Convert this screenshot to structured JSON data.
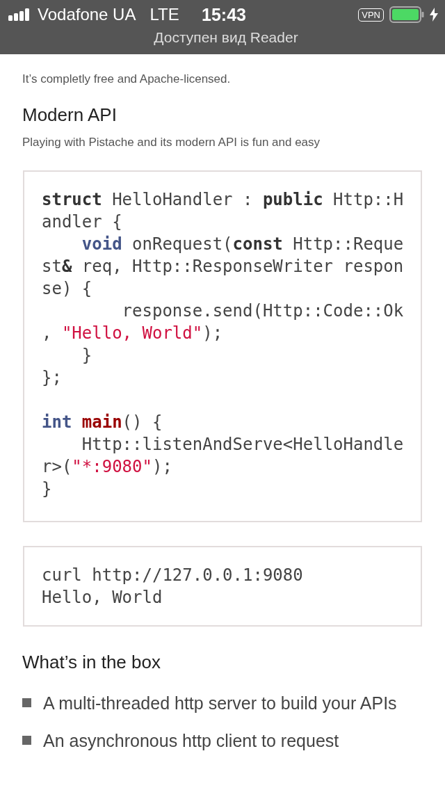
{
  "status_bar": {
    "carrier": "Vodafone UA",
    "network": "LTE",
    "time": "15:43",
    "vpn": "VPN",
    "reader_notice": "Доступен вид Reader"
  },
  "intro": "It’s completly free and Apache-licensed.",
  "modern_api": {
    "heading": "Modern API",
    "subtitle": "Playing with Pistache and its modern API is fun and easy"
  },
  "code_blocks": [
    {
      "lines": [
        {
          "kind": "code",
          "segments": [
            {
              "t": "struct",
              "kind": "keyword"
            },
            {
              "t": " HelloHandler : ",
              "kind": "plain"
            },
            {
              "t": "public",
              "kind": "keyword"
            },
            {
              "t": " Http::H",
              "kind": "plain"
            }
          ]
        },
        {
          "kind": "code",
          "segments": [
            {
              "t": "andler {",
              "kind": "plain"
            }
          ]
        },
        {
          "kind": "code",
          "segments": [
            {
              "t": "    void",
              "kind": "type"
            },
            {
              "t": " onRequest(",
              "kind": "plain"
            },
            {
              "t": "const",
              "kind": "keyword"
            },
            {
              "t": " Http::Reque",
              "kind": "plain"
            }
          ]
        },
        {
          "kind": "code",
          "segments": [
            {
              "t": "st",
              "kind": "plain"
            },
            {
              "t": "&",
              "kind": "keyword"
            },
            {
              "t": " req, Http::ResponseWriter respon",
              "kind": "plain"
            }
          ]
        },
        {
          "kind": "code",
          "segments": [
            {
              "t": "se) {",
              "kind": "plain"
            }
          ]
        },
        {
          "kind": "code",
          "segments": [
            {
              "t": "        response.send(Http::Code::Ok",
              "kind": "plain"
            }
          ]
        },
        {
          "kind": "code",
          "segments": [
            {
              "t": ", ",
              "kind": "plain"
            },
            {
              "t": "\"Hello, World\"",
              "kind": "string"
            },
            {
              "t": ");",
              "kind": "plain"
            }
          ]
        },
        {
          "kind": "code",
          "segments": [
            {
              "t": "    }",
              "kind": "plain"
            }
          ]
        },
        {
          "kind": "code",
          "segments": [
            {
              "t": "};",
              "kind": "plain"
            }
          ]
        },
        {
          "kind": "blank"
        },
        {
          "kind": "code",
          "segments": [
            {
              "t": "int",
              "kind": "type"
            },
            {
              "t": " main",
              "kind": "func"
            },
            {
              "t": "() {",
              "kind": "plain"
            }
          ]
        },
        {
          "kind": "code",
          "segments": [
            {
              "t": "    Http::listenAndServe<HelloHandle",
              "kind": "plain"
            }
          ]
        },
        {
          "kind": "code",
          "segments": [
            {
              "t": "r>(",
              "kind": "plain"
            },
            {
              "t": "\"*:9080\"",
              "kind": "string"
            },
            {
              "t": ");",
              "kind": "plain"
            }
          ]
        },
        {
          "kind": "code",
          "segments": [
            {
              "t": "}",
              "kind": "plain"
            }
          ]
        }
      ]
    },
    {
      "lines": [
        {
          "kind": "code",
          "segments": [
            {
              "t": "curl http://127.0.0.1:9080",
              "kind": "plain"
            }
          ]
        },
        {
          "kind": "code",
          "segments": [
            {
              "t": "Hello, World",
              "kind": "plain"
            }
          ]
        }
      ]
    }
  ],
  "features": {
    "heading": "What’s in the box",
    "items": [
      "A multi-threaded http server to build your APIs",
      "An asynchronous http client to request"
    ]
  }
}
